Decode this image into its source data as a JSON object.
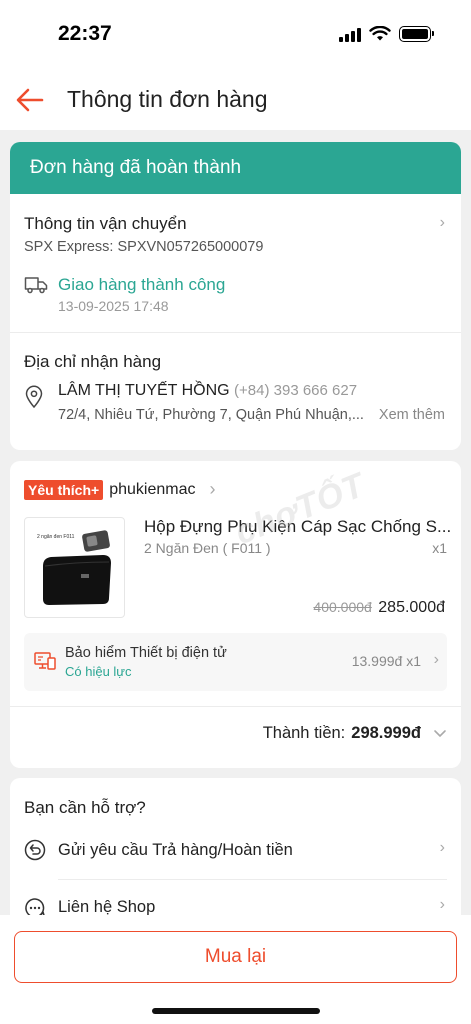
{
  "status_bar": {
    "time": "22:37"
  },
  "header": {
    "title": "Thông tin đơn hàng"
  },
  "order_status": {
    "banner": "Đơn hàng đã hoàn thành"
  },
  "shipping": {
    "title": "Thông tin vận chuyển",
    "carrier": "SPX Express: SPXVN057265000079",
    "status": "Giao hàng thành công",
    "datetime": "13-09-2025 17:48"
  },
  "address": {
    "title": "Địa chỉ nhận hàng",
    "name": "LÂM THỊ TUYẾT HỒNG",
    "phone": "(+84) 393 666 627",
    "detail": "72/4, Nhiêu Tứ, Phường 7, Quận Phú Nhuận,...",
    "more": "Xem thêm"
  },
  "shop": {
    "badge": "Yêu thích+",
    "name": "phukienmac",
    "product": {
      "title": "Hộp Đựng Phụ Kiện Cáp Sạc Chống S...",
      "variant": "2 Ngăn Đen ( F011 )",
      "qty": "x1",
      "old_price": "400.000đ",
      "price": "285.000đ",
      "thumb_text": "2 ngăn đen F011"
    },
    "insurance": {
      "title": "Bảo hiểm Thiết bị điện tử",
      "status": "Có hiệu lực",
      "price": "13.999đ",
      "qty": "x1"
    },
    "total_label": "Thành tiền:",
    "total_value": "298.999đ"
  },
  "support": {
    "title": "Bạn cần hỗ trợ?",
    "return_label": "Gửi yêu cầu Trả hàng/Hoàn tiền",
    "contact_label": "Liên hệ Shop"
  },
  "footer": {
    "buy_again": "Mua lại"
  },
  "watermark": "chợTỐT",
  "colors": {
    "accent": "#ee4d2d",
    "teal": "#2ba693"
  }
}
